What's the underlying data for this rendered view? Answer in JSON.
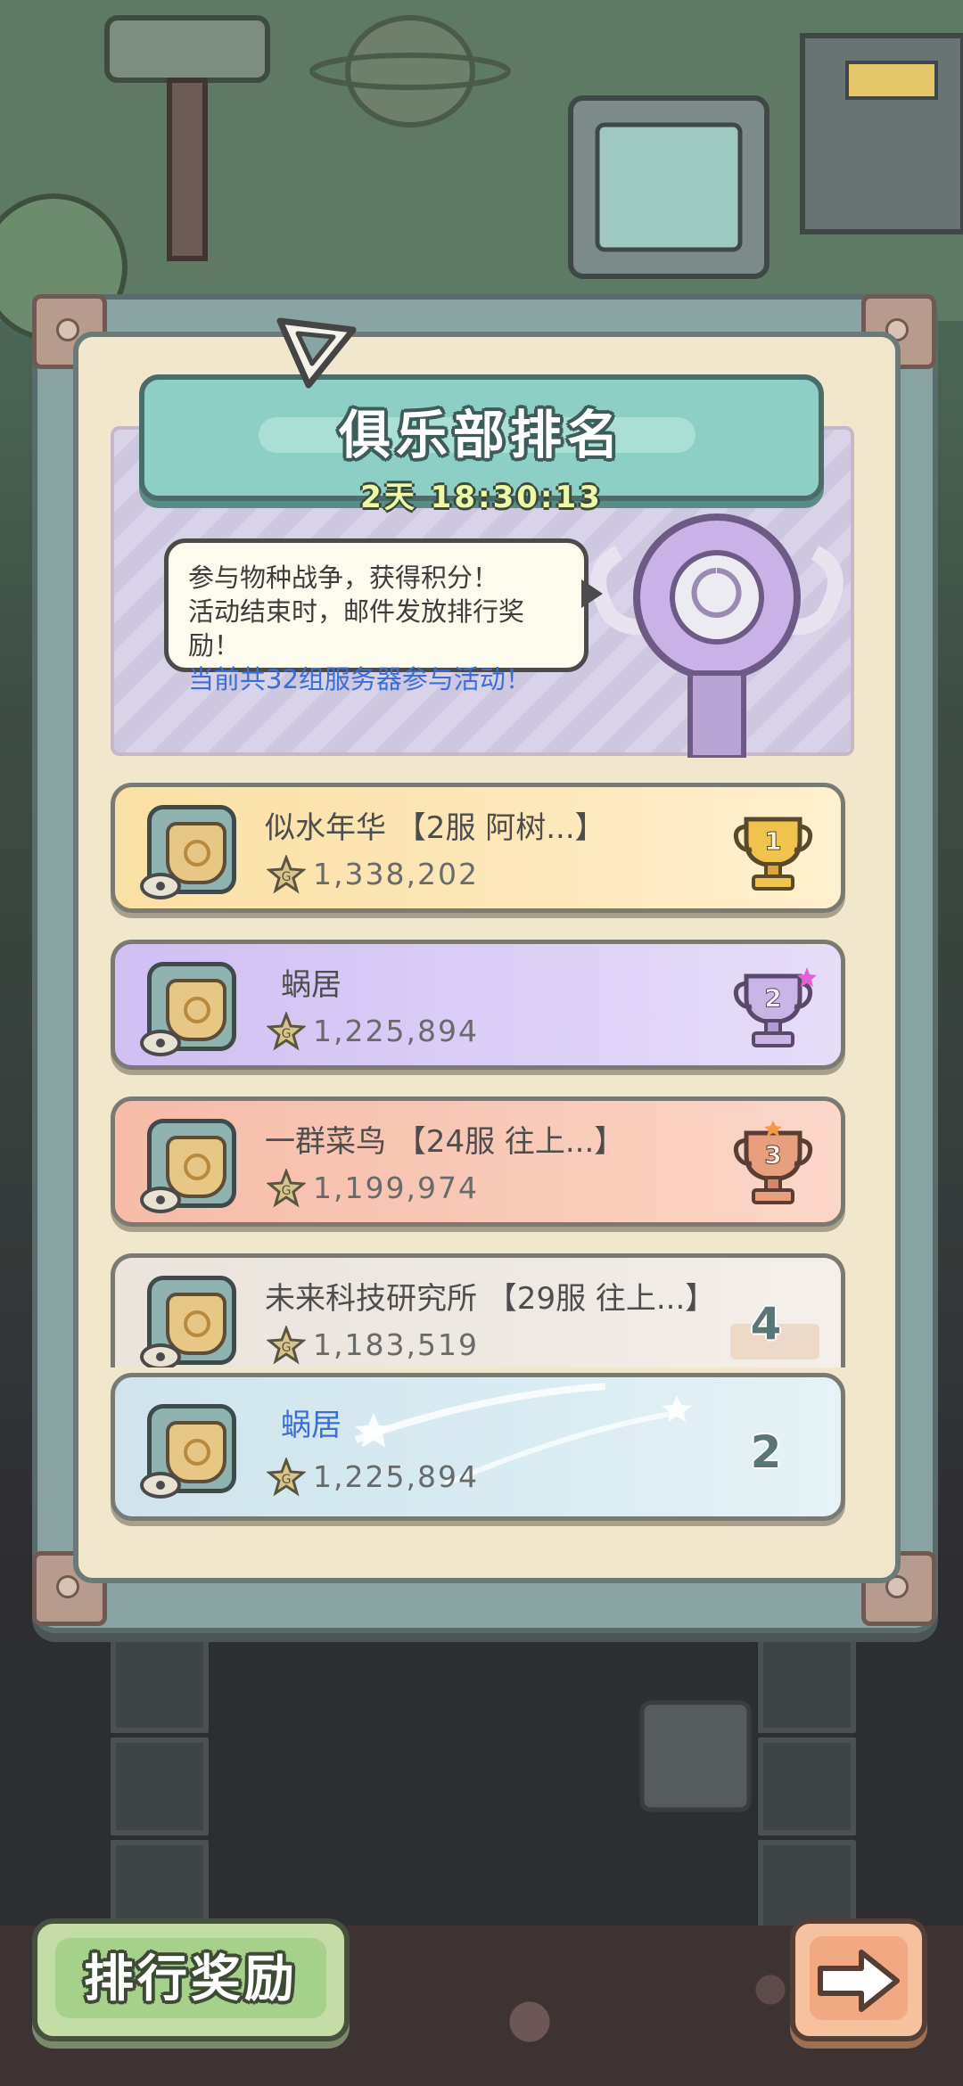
{
  "event": {
    "title": "俱乐部排名",
    "countdown": "2天 18:30:13",
    "info_lines": [
      "参与物种战争，获得积分！",
      "活动结束时，邮件发放排行奖励！",
      "当前共32组服务器参与活动！"
    ]
  },
  "rankings": [
    {
      "rank": "1",
      "name": "似水年华 【2服  阿树...】",
      "score": "1,338,202",
      "style": "gold",
      "trophy": "gold-trophy-icon"
    },
    {
      "rank": "2",
      "name": "蜗居",
      "score": "1,225,894",
      "style": "purple",
      "trophy": "silver-trophy-icon"
    },
    {
      "rank": "3",
      "name": "一群菜鸟 【24服  往上...】",
      "score": "1,199,974",
      "style": "salmon",
      "trophy": "bronze-trophy-icon"
    },
    {
      "rank": "4",
      "name": "未来科技研究所 【29服  往上...】",
      "score": "1,183,519",
      "style": "grey"
    }
  ],
  "my_club": {
    "rank": "2",
    "name": "蜗居",
    "score": "1,225,894"
  },
  "buttons": {
    "reward": "排行奖励",
    "next_icon": "arrow-right-icon"
  },
  "colors": {
    "highlight_text": "#3b6fd6",
    "title_bg": "#8ecfc5",
    "panel_bg": "#f1e7cd"
  }
}
